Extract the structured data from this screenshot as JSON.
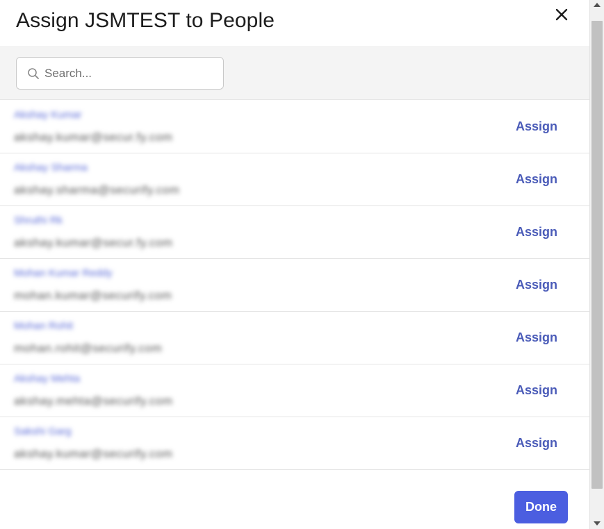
{
  "dialog": {
    "title": "Assign JSMTEST to People",
    "close_icon": "close-icon"
  },
  "search": {
    "placeholder": "Search...",
    "value": "",
    "icon": "search-icon"
  },
  "people": [
    {
      "name": "Akshay Kumar",
      "email": "akshay.kumar@secur.fy.com",
      "action": "Assign"
    },
    {
      "name": "Akshay Sharma",
      "email": "akshay.sharma@securify.com",
      "action": "Assign"
    },
    {
      "name": "Shruthi Rk",
      "email": "akshay.kumar@secur.fy.com",
      "action": "Assign"
    },
    {
      "name": "Mohan Kumar Reddy",
      "email": "mohan.kumar@securify.com",
      "action": "Assign"
    },
    {
      "name": "Mohan Rohit",
      "email": "mohan.rohit@securify.com",
      "action": "Assign"
    },
    {
      "name": "Akshay Mehta",
      "email": "akshay.mehta@securify.com",
      "action": "Assign"
    },
    {
      "name": "Sakshi Garg",
      "email": "akshay.kumar@securify.com",
      "action": "Assign"
    }
  ],
  "footer": {
    "done_label": "Done"
  },
  "colors": {
    "primary": "#4b5ee0",
    "link": "#4a5bb8"
  }
}
